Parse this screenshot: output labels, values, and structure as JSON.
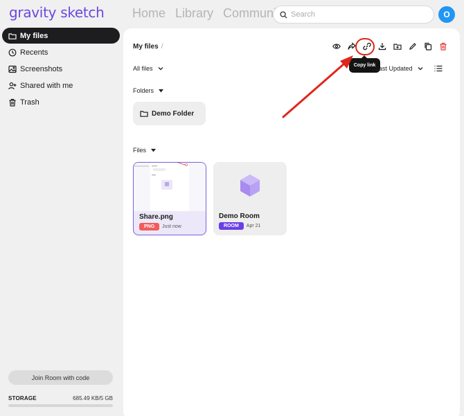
{
  "app": {
    "logo": "gravity sketch"
  },
  "topnav": {
    "items": [
      "Home",
      "Library",
      "Community"
    ]
  },
  "search": {
    "placeholder": "Search"
  },
  "user": {
    "initial": "O",
    "avatar_color": "#2196f3"
  },
  "sidebar": {
    "items": [
      {
        "label": "My files",
        "icon": "folder-icon",
        "active": true
      },
      {
        "label": "Recents",
        "icon": "clock-icon",
        "active": false
      },
      {
        "label": "Screenshots",
        "icon": "image-icon",
        "active": false
      },
      {
        "label": "Shared with me",
        "icon": "person-add-icon",
        "active": false
      },
      {
        "label": "Trash",
        "icon": "trash-icon",
        "active": false
      }
    ],
    "join_button": "Join Room with code",
    "storage": {
      "label": "STORAGE",
      "value": "685.49 KB/5 GB",
      "fraction_used": 0.0001
    }
  },
  "main": {
    "breadcrumb": {
      "current": "My files",
      "separator": "/"
    },
    "toolbar": {
      "icons": [
        "eye-icon",
        "share-icon",
        "link-icon",
        "download-icon",
        "add-folder-icon",
        "pencil-icon",
        "duplicate-icon",
        "trash-icon"
      ],
      "tooltip": "Copy link"
    },
    "filter": {
      "label": "All files"
    },
    "sort": {
      "label": "Last Updated"
    },
    "folders_section": {
      "label": "Folders"
    },
    "folders": [
      {
        "name": "Demo Folder"
      }
    ],
    "files_section": {
      "label": "Files"
    },
    "files": [
      {
        "name": "Share.png",
        "badge": "PNG",
        "badge_color": "#f25c5c",
        "date": "Just now",
        "selected": true
      },
      {
        "name": "Demo Room",
        "badge": "ROOM",
        "badge_color": "#6b3fe8",
        "date": "Apr 21",
        "selected": false
      }
    ]
  },
  "colors": {
    "brand": "#6b47e0",
    "annotation": "#e0261b",
    "delete": "#e53935"
  }
}
